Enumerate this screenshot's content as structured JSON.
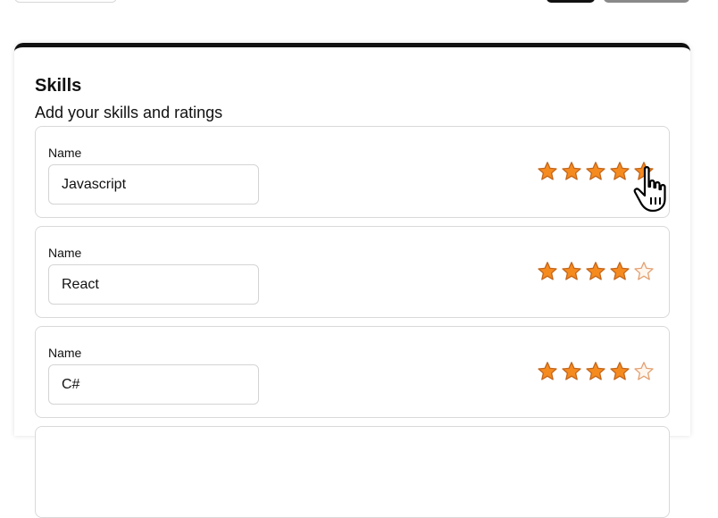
{
  "colors": {
    "star_fill": "#f58a1f",
    "star_stroke": "#c4661a",
    "star_empty_fill": "#fff6ee",
    "star_empty_stroke": "#e3a070",
    "card_top_border": "#111111"
  },
  "card": {
    "title": "Skills",
    "subtitle": "Add your skills and ratings"
  },
  "skills": [
    {
      "label": "Name",
      "value": "Javascript",
      "rating": 5,
      "max_rating": 5
    },
    {
      "label": "Name",
      "value": "React",
      "rating": 4,
      "max_rating": 5
    },
    {
      "label": "Name",
      "value": "C#",
      "rating": 4,
      "max_rating": 5
    }
  ],
  "icons": {
    "cursor": "hand-pointer-icon",
    "star": "star-icon"
  }
}
